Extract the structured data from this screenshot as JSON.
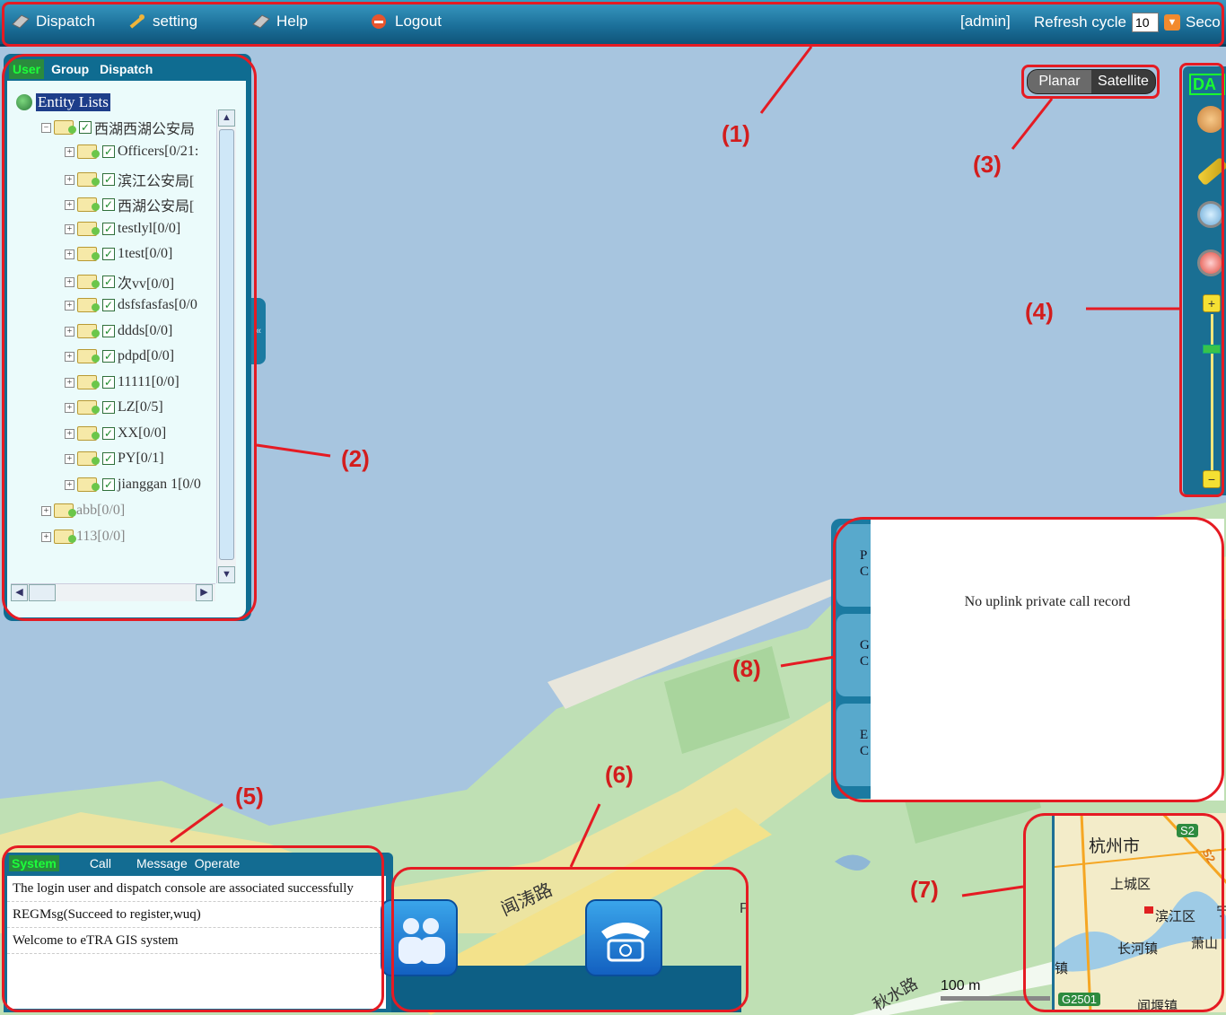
{
  "topbar": {
    "items": [
      {
        "label": "Dispatch",
        "icon": "dispatch-icon"
      },
      {
        "label": "setting",
        "icon": "wrench-icon"
      },
      {
        "label": "Help",
        "icon": "help-icon"
      },
      {
        "label": "Logout",
        "icon": "logout-icon"
      }
    ],
    "user": "[admin]",
    "refresh_label": "Refresh cycle",
    "refresh_value": "10",
    "refresh_unit": "Seco"
  },
  "left_panel": {
    "tabs": [
      "User",
      "Group",
      "Dispatch"
    ],
    "active_tab": "User",
    "root_label": "Entity Lists",
    "org_label": "西湖西湖公安局",
    "nodes": [
      "Officers[0/21:",
      "滨江公安局[",
      "西湖公安局[",
      "testlyl[0/0]",
      "1test[0/0]",
      "次vv[0/0]",
      "dsfsfasfas[0/0",
      "ddds[0/0]",
      "pdpd[0/0]",
      "11111[0/0]",
      "LZ[0/5]",
      "XX[0/0]",
      "PY[0/1]",
      "jianggan 1[0/0"
    ],
    "top_nodes": [
      "abb[0/0]",
      "113[0/0]"
    ]
  },
  "map_type": {
    "planar": "Planar",
    "satellite": "Satellite"
  },
  "toolbar": {
    "da_label": "DA"
  },
  "call_panel": {
    "tabs": [
      [
        "P",
        "C"
      ],
      [
        "G",
        "C"
      ],
      [
        "E",
        "C"
      ]
    ],
    "message": "No uplink private call record"
  },
  "msg_panel": {
    "tabs": [
      "System",
      "Call",
      "Message",
      "Operate"
    ],
    "rows": [
      "The login user and dispatch console are associated successfully",
      "REGMsg(Succeed to register,wuq)",
      "Welcome to eTRA GIS system"
    ]
  },
  "map": {
    "road1": "闻涛路",
    "road2": "秋水路",
    "letter": "P",
    "scale": "100 m"
  },
  "minimap": {
    "city": "杭州市",
    "district1": "上城区",
    "district2": "滨江区",
    "district3": "长河镇",
    "district4": "萧山",
    "shield1": "S2",
    "shield2": "S2",
    "shield3": "G2501",
    "partial1": "镇",
    "partial2": "闻堰镇",
    "partial3": "宁"
  },
  "annotations": [
    "(1)",
    "(2)",
    "(3)",
    "(4)",
    "(5)",
    "(6)",
    "(7)",
    "(8)"
  ],
  "colors": {
    "annotation": "#e51b23",
    "active_tab": "#1cff3a",
    "panel": "#1b6f99"
  }
}
